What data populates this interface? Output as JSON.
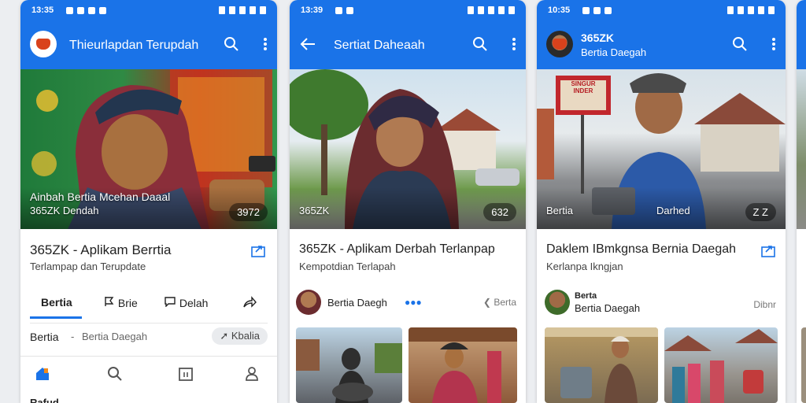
{
  "phones": [
    {
      "status_time": "13:35",
      "app_title": "Thieurlapdan Terupdah",
      "hero": {
        "caption_line1": "Ainbah Bertia Mcehan Daaal",
        "caption_line2": "365ZK Dendah",
        "pill": "3972"
      },
      "headline": "365ZK - Aplikam Berrtia",
      "subtitle": "Terlampap dan Terupdate",
      "tabs": [
        {
          "label": "Bertia",
          "icon": ""
        },
        {
          "label": "Brie",
          "icon": "flag-icon"
        },
        {
          "label": "Delah",
          "icon": "comment-icon"
        },
        {
          "label": "",
          "icon": "share-arrow-icon"
        }
      ],
      "breadcrumb": {
        "first": "Bertia",
        "sep": "-",
        "second": "Bertia Daegah"
      },
      "chip": "Kbalia",
      "bottom_nav": [
        "home-icon",
        "search-icon",
        "calendar-icon",
        "profile-icon"
      ],
      "below_nav_label": "Rafud"
    },
    {
      "status_time": "13:39",
      "app_title": "Sertiat Daheaah",
      "hero": {
        "caption_line1": "",
        "caption_line2": "365ZK",
        "pill": "632"
      },
      "headline": "365ZK - Aplikam Derbah Terlanpap",
      "subtitle": "Kempotdian Terlapah",
      "author": "Bertia Daegh",
      "author_action": "Berta"
    },
    {
      "status_time": "10:35",
      "app_title_line1": "365ZK",
      "app_title_line2": "Bertia Daegah",
      "sign_text": "SINGUR INDER",
      "hero": {
        "caption_line1": "",
        "caption_line2": "Bertia",
        "caption_mid": "Darhed",
        "pill": "Z Z"
      },
      "headline": "Daklem IBmkgnsa Bernia Daegah",
      "subtitle": "Kerlanpa Ikngjan",
      "author_line1": "Berta",
      "author_line2": "Bertia Daegah",
      "author_right": "Dibnr"
    }
  ],
  "colors": {
    "accent": "#1a73e8",
    "text": "#222222",
    "muted": "#666666"
  }
}
